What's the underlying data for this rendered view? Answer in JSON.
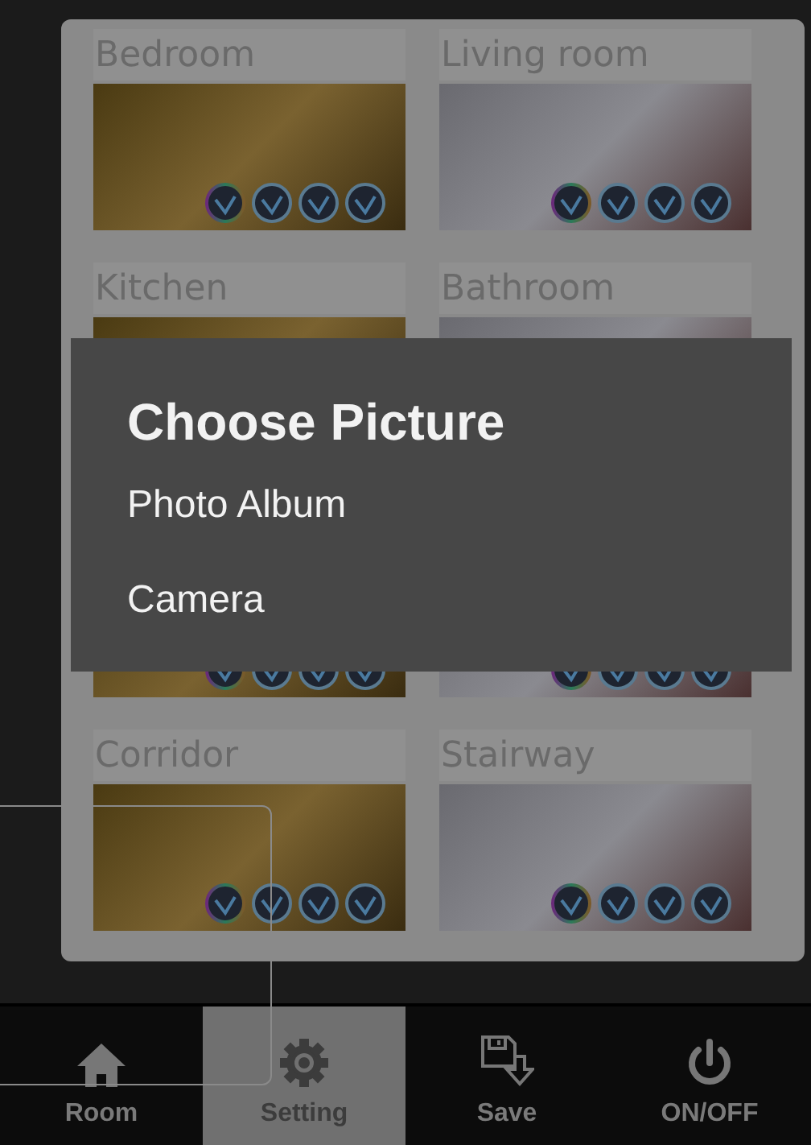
{
  "rooms": [
    {
      "name": "Bedroom"
    },
    {
      "name": "Living room"
    },
    {
      "name": "Kitchen"
    },
    {
      "name": "Bathroom"
    },
    {
      "name": "Corridor"
    },
    {
      "name": "Stairway"
    }
  ],
  "dialog": {
    "title": "Choose Picture",
    "options": [
      "Photo Album",
      "Camera"
    ]
  },
  "tabs": [
    {
      "label": "Room",
      "selected": false
    },
    {
      "label": "Setting",
      "selected": true
    },
    {
      "label": "Save",
      "selected": false
    },
    {
      "label": "ON/OFF",
      "selected": false
    }
  ]
}
